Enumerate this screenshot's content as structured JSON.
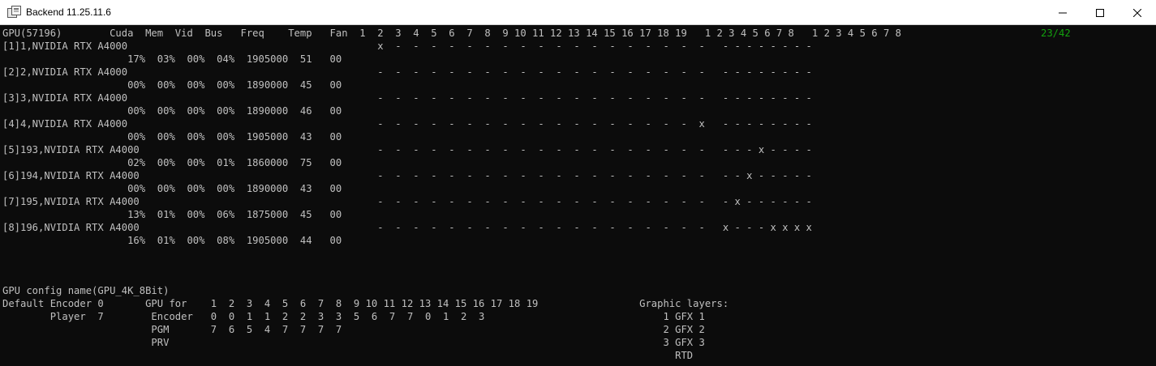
{
  "window": {
    "title": "Backend 11.25.11.6",
    "icon": "console-app-icon",
    "controls": [
      "minimize",
      "maximize",
      "close"
    ]
  },
  "console": {
    "lines": [
      {
        "id": "gpu-header",
        "text": "GPU(57196)        Cuda  Mem  Vid  Bus   Freq    Temp   Fan  1  2  3  4  5  6  7  8  9 10 11 12 13 14 15 16 17 18 19   1 2 3 4 5 6 7 8   1 2 3 4 5 6 7 8",
        "counter": "23/42"
      },
      {
        "id": "gpu1-name",
        "text": "[1]1,NVIDIA RTX A4000                                          x  -  -  -  -  -  -  -  -  -  -  -  -  -  -  -  -  -  -   - - - - - - - -"
      },
      {
        "id": "gpu1-stats",
        "text": "                     17%  03%  00%  04%  1905000  51   00"
      },
      {
        "id": "gpu2-name",
        "text": "[2]2,NVIDIA RTX A4000                                          -  -  -  -  -  -  -  -  -  -  -  -  -  -  -  -  -  -  -   - - - - - - - -"
      },
      {
        "id": "gpu2-stats",
        "text": "                     00%  00%  00%  00%  1890000  45   00"
      },
      {
        "id": "gpu3-name",
        "text": "[3]3,NVIDIA RTX A4000                                          -  -  -  -  -  -  -  -  -  -  -  -  -  -  -  -  -  -  -   - - - - - - - -"
      },
      {
        "id": "gpu3-stats",
        "text": "                     00%  00%  00%  00%  1890000  46   00"
      },
      {
        "id": "gpu4-name",
        "text": "[4]4,NVIDIA RTX A4000                                          -  -  -  -  -  -  -  -  -  -  -  -  -  -  -  -  -  -  x   - - - - - - - -"
      },
      {
        "id": "gpu4-stats",
        "text": "                     00%  00%  00%  00%  1905000  43   00"
      },
      {
        "id": "gpu5-name",
        "text": "[5]193,NVIDIA RTX A4000                                        -  -  -  -  -  -  -  -  -  -  -  -  -  -  -  -  -  -  -   - - - x - - - -"
      },
      {
        "id": "gpu5-stats",
        "text": "                     02%  00%  00%  01%  1860000  75   00"
      },
      {
        "id": "gpu6-name",
        "text": "[6]194,NVIDIA RTX A4000                                        -  -  -  -  -  -  -  -  -  -  -  -  -  -  -  -  -  -  -   - - x - - - - -"
      },
      {
        "id": "gpu6-stats",
        "text": "                     00%  00%  00%  00%  1890000  43   00"
      },
      {
        "id": "gpu7-name",
        "text": "[7]195,NVIDIA RTX A4000                                        -  -  -  -  -  -  -  -  -  -  -  -  -  -  -  -  -  -  -   - x - - - - - -"
      },
      {
        "id": "gpu7-stats",
        "text": "                     13%  01%  00%  06%  1875000  45   00"
      },
      {
        "id": "gpu8-name",
        "text": "[8]196,NVIDIA RTX A4000                                        -  -  -  -  -  -  -  -  -  -  -  -  -  -  -  -  -  -  -   x - - - x x x x"
      },
      {
        "id": "gpu8-stats",
        "text": "                     16%  01%  00%  08%  1905000  44   00"
      },
      {
        "id": "blank-1",
        "text": ""
      },
      {
        "id": "blank-2",
        "text": ""
      },
      {
        "id": "blank-3",
        "text": ""
      },
      {
        "id": "config-name",
        "text": "GPU config name(GPU_4K_8Bit)"
      },
      {
        "id": "config-encoder",
        "text": "Default Encoder 0       GPU for    1  2  3  4  5  6  7  8  9 10 11 12 13 14 15 16 17 18 19                 Graphic layers:"
      },
      {
        "id": "config-player",
        "text": "        Player  7        Encoder   0  0  1  1  2  2  3  3  5  6  7  7  0  1  2  3                              1 GFX 1"
      },
      {
        "id": "config-pgm",
        "text": "                         PGM       7  6  5  4  7  7  7  7                                                      2 GFX 2"
      },
      {
        "id": "config-prv",
        "text": "                         PRV                                                                                   3 GFX 3"
      },
      {
        "id": "config-rtd",
        "text": "                                                                                                                 RTD"
      }
    ]
  },
  "colors": {
    "background": "#0c0c0c",
    "text": "#c0c0c0",
    "counter": "#13a10e"
  }
}
